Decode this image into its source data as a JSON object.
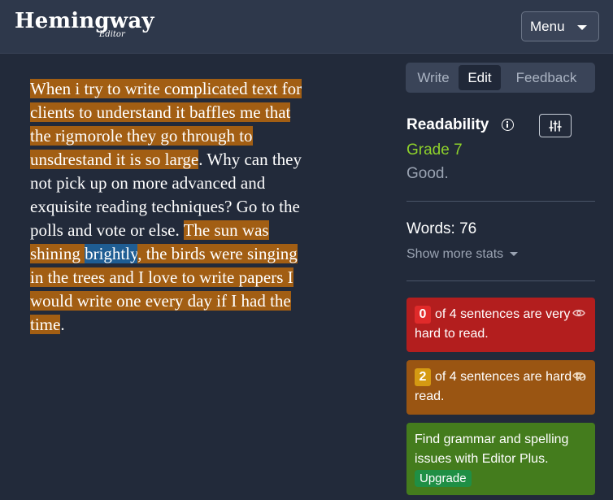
{
  "header": {
    "logo_main": "Hemingway",
    "logo_sub": "Editor",
    "menu_label": "Menu"
  },
  "editor": {
    "segments": [
      {
        "text": "When i try to write complicated text for clients to understand it baffles me that the rigmorole they go through to unsdrestand it is so large",
        "highlight": "hard"
      },
      {
        "text": ". Why can they not pick up on more advanced and exquisite reading techniques? Go to the polls and vote or else. ",
        "highlight": "none"
      },
      {
        "text": "The sun was shining ",
        "highlight": "hard"
      },
      {
        "text": "brightly",
        "highlight": "adverb"
      },
      {
        "text": ", the birds were singing in the trees and I love to write papers I would write one every day if I had the time",
        "highlight": "hard"
      },
      {
        "text": ".",
        "highlight": "none"
      }
    ]
  },
  "tabs": [
    {
      "label": "Write",
      "active": false
    },
    {
      "label": "Edit",
      "active": true
    },
    {
      "label": "Feedback",
      "active": false
    }
  ],
  "readability": {
    "title": "Readability",
    "grade": "Grade 7",
    "description": "Good."
  },
  "stats": {
    "words": "Words: 76",
    "show_more": "Show more stats"
  },
  "cards": {
    "very_hard": {
      "count": "0",
      "text": "of 4 sentences are very hard to read."
    },
    "hard": {
      "count": "2",
      "text": "of 4 sentences are hard to read."
    },
    "plus": {
      "text": "Find grammar and spelling issues with Editor Plus.",
      "button": "Upgrade"
    }
  },
  "colors": {
    "background": "#222a3a",
    "header": "#2e384b",
    "hard_highlight": "#a25e13",
    "adverb_highlight": "#1f5d93",
    "grade_green": "#8ed12b",
    "very_hard_card": "#b31e1e",
    "hard_card": "#9a5512",
    "plus_card": "#447c1d"
  },
  "icons": [
    "info-icon",
    "sliders-icon",
    "eye-icon",
    "chevron-down-icon"
  ]
}
